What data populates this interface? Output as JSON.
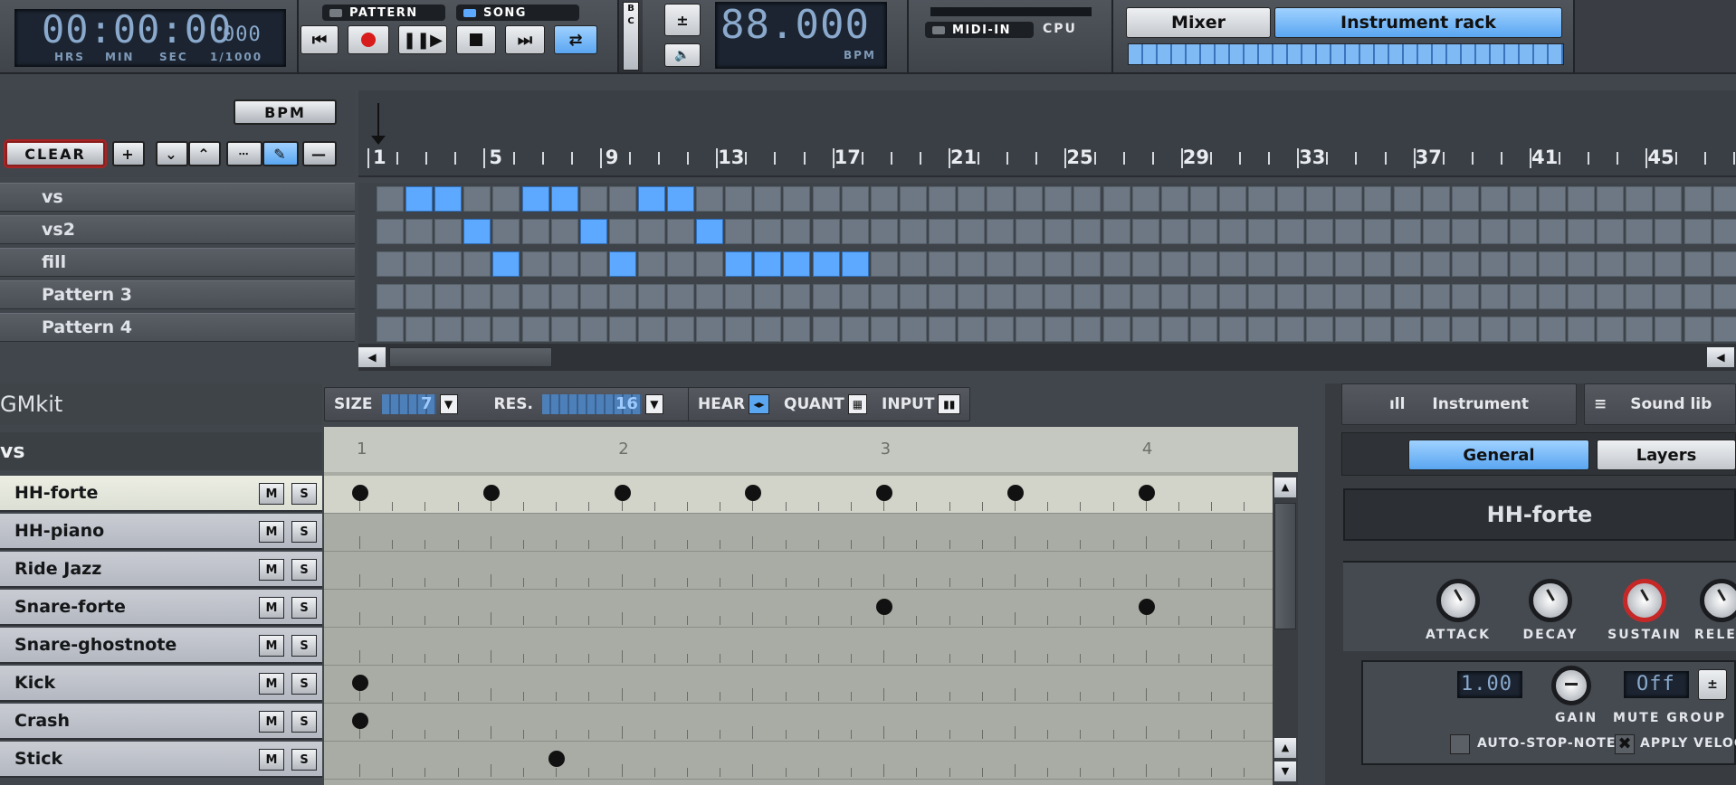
{
  "transport": {
    "time": "00:00:00",
    "time_ms": "000",
    "time_labels": [
      "HRS",
      "MIN",
      "SEC",
      "1/1000"
    ],
    "mode_pattern": "PATTERN",
    "mode_song": "SONG",
    "bpm_value": "88.000",
    "bpm_label": "BPM",
    "bc_label": "B C"
  },
  "midi": {
    "label": "MIDI-IN",
    "cpu_label": "CPU"
  },
  "view_tabs": {
    "mixer": "Mixer",
    "instrument_rack": "Instrument rack"
  },
  "song_editor": {
    "bpm_button": "BPM",
    "clear_button": "CLEAR",
    "ruler_numbers": [
      "1",
      "5",
      "9",
      "13",
      "17",
      "21",
      "25",
      "29",
      "33",
      "37",
      "41",
      "45"
    ],
    "patterns": [
      {
        "name": "vs",
        "active": [
          1,
          2,
          5,
          6,
          9,
          10
        ]
      },
      {
        "name": "vs2",
        "active": [
          3,
          7,
          11
        ]
      },
      {
        "name": "fill",
        "active": [
          4,
          8,
          12,
          13,
          14,
          15,
          16
        ]
      },
      {
        "name": "Pattern 3",
        "active": []
      },
      {
        "name": "Pattern 4",
        "active": []
      }
    ]
  },
  "pattern_editor": {
    "drumkit_name": "GMkit",
    "pattern_name": "vs",
    "size_label": "SIZE",
    "size_value": "7",
    "res_label": "RES.",
    "res_value": "16",
    "hear_label": "HEAR",
    "quant_label": "QUANT",
    "input_label": "INPUT",
    "beat_numbers": [
      "1",
      "2",
      "3",
      "4"
    ],
    "mute_label": "M",
    "solo_label": "S",
    "instruments": [
      {
        "name": "HH-forte",
        "notes": [
          0,
          4,
          8,
          12,
          16,
          20,
          24
        ]
      },
      {
        "name": "HH-piano",
        "notes": []
      },
      {
        "name": "Ride Jazz",
        "notes": []
      },
      {
        "name": "Snare-forte",
        "notes": [
          16,
          24
        ]
      },
      {
        "name": "Snare-ghostnote",
        "notes": []
      },
      {
        "name": "Kick",
        "notes": [
          0
        ]
      },
      {
        "name": "Crash",
        "notes": [
          0
        ]
      },
      {
        "name": "Stick",
        "notes": [
          6
        ]
      }
    ]
  },
  "instrument_panel": {
    "tab_instrument": "Instrument",
    "tab_sound_library": "Sound lib",
    "subtab_general": "General",
    "subtab_layers": "Layers",
    "instrument_name": "HH-forte",
    "envelope_labels": [
      "ATTACK",
      "DECAY",
      "SUSTAIN",
      "RELE"
    ],
    "gain_value": "1.00",
    "gain_label": "GAIN",
    "mute_group_value": "Off",
    "mute_group_label": "MUTE GROUP",
    "auto_stop_note": "AUTO-STOP-NOTE",
    "apply_velocity": "APPLY VELOCI"
  },
  "colors": {
    "accent_blue": "#5da9ff",
    "grid_cell": "#6e7884",
    "note_bg": "#a9aca4"
  }
}
